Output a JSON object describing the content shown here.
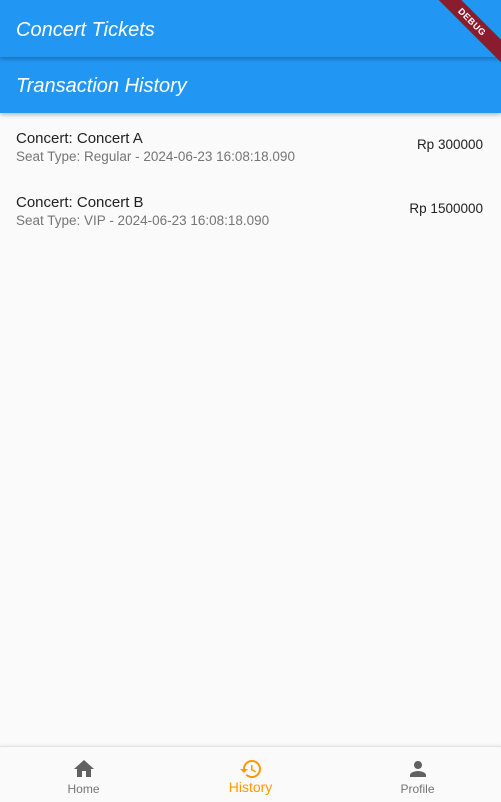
{
  "app_bar": {
    "title": "Concert Tickets"
  },
  "sub_bar": {
    "title": "Transaction History"
  },
  "debug_banner": "DEBUG",
  "transactions": [
    {
      "title": "Concert: Concert A",
      "subtitle": "Seat Type: Regular - 2024-06-23 16:08:18.090",
      "amount": "Rp 300000"
    },
    {
      "title": "Concert: Concert B",
      "subtitle": "Seat Type: VIP - 2024-06-23 16:08:18.090",
      "amount": "Rp 1500000"
    }
  ],
  "bottom_nav": {
    "items": [
      {
        "label": "Home",
        "icon": "home-icon",
        "active": false
      },
      {
        "label": "History",
        "icon": "history-icon",
        "active": true
      },
      {
        "label": "Profile",
        "icon": "person-icon",
        "active": false
      }
    ]
  },
  "colors": {
    "primary": "#2196f3",
    "active_nav": "#ff9800",
    "inactive_nav": "#757575",
    "debug_banner": "#8a1c2e"
  }
}
